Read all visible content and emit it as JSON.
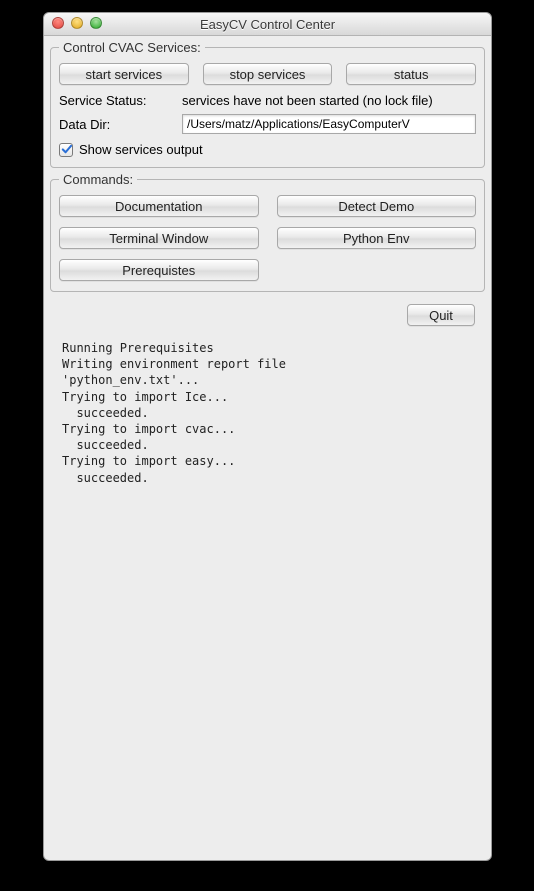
{
  "window": {
    "title": "EasyCV Control Center"
  },
  "services_group": {
    "legend": "Control CVAC Services:",
    "start_label": "start services",
    "stop_label": "stop services",
    "status_label": "status",
    "service_status_label": "Service Status:",
    "service_status_value": "services have not been started (no lock file)",
    "data_dir_label": "Data Dir:",
    "data_dir_value": "/Users/matz/Applications/EasyComputerV",
    "show_output_label": "Show services output",
    "show_output_checked": true
  },
  "commands_group": {
    "legend": "Commands:",
    "documentation_label": "Documentation",
    "detect_demo_label": "Detect Demo",
    "terminal_window_label": "Terminal Window",
    "python_env_label": "Python Env",
    "prerequisites_label": "Prerequistes"
  },
  "quit_label": "Quit",
  "output_text": "Running Prerequisites\nWriting environment report file\n'python_env.txt'...\nTrying to import Ice...\n  succeeded.\nTrying to import cvac...\n  succeeded.\nTrying to import easy...\n  succeeded."
}
